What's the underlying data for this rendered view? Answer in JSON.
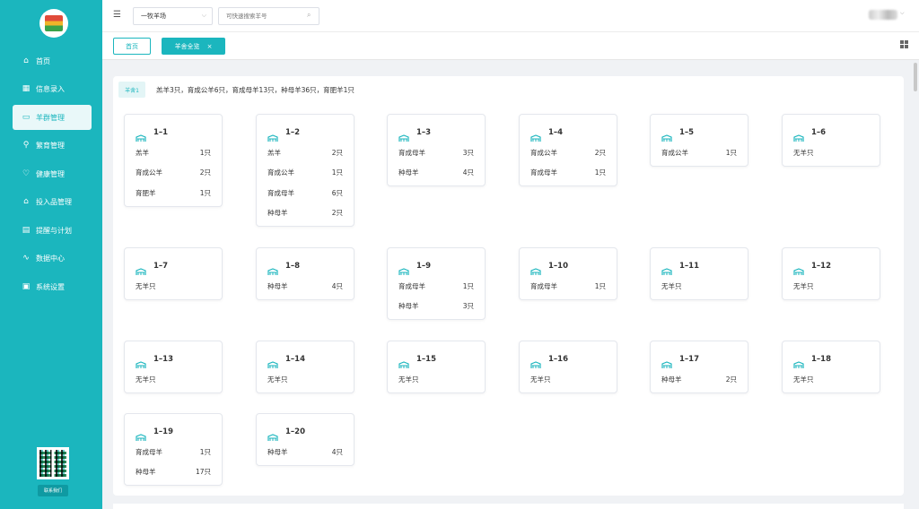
{
  "sidebar": {
    "items": [
      {
        "label": "首页",
        "icon": "home-icon",
        "glyph": "⌂"
      },
      {
        "label": "信息录入",
        "icon": "grid-icon",
        "glyph": "▦"
      },
      {
        "label": "羊群管理",
        "icon": "pen-icon",
        "glyph": "▭",
        "active": true
      },
      {
        "label": "繁育管理",
        "icon": "breeding-icon",
        "glyph": "⚲"
      },
      {
        "label": "健康管理",
        "icon": "health-icon",
        "glyph": "♡"
      },
      {
        "label": "投入品管理",
        "icon": "supplies-icon",
        "glyph": "⌂"
      },
      {
        "label": "提醒与计划",
        "icon": "calendar-icon",
        "glyph": "▤"
      },
      {
        "label": "数据中心",
        "icon": "chart-icon",
        "glyph": "∿"
      },
      {
        "label": "系统设置",
        "icon": "settings-icon",
        "glyph": "▣"
      }
    ],
    "contact_label": "联系我们"
  },
  "topbar": {
    "farm_select": "一牧羊场",
    "search_placeholder": "可快速搜索羊号"
  },
  "tabs": {
    "home": "首页",
    "active": "羊舍全览",
    "close": "×"
  },
  "summary": {
    "tag": "羊舍1",
    "text": "羔羊3只，育成公羊6只，育成母羊13只，种母羊36只，育肥羊1只"
  },
  "pens": [
    {
      "name": "1–1",
      "rows": [
        [
          "羔羊",
          "1只"
        ],
        [
          "育成公羊",
          "2只"
        ],
        [
          "育肥羊",
          "1只"
        ]
      ]
    },
    {
      "name": "1–2",
      "rows": [
        [
          "羔羊",
          "2只"
        ],
        [
          "育成公羊",
          "1只"
        ],
        [
          "育成母羊",
          "6只"
        ],
        [
          "种母羊",
          "2只"
        ]
      ]
    },
    {
      "name": "1–3",
      "rows": [
        [
          "育成母羊",
          "3只"
        ],
        [
          "种母羊",
          "4只"
        ]
      ]
    },
    {
      "name": "1–4",
      "rows": [
        [
          "育成公羊",
          "2只"
        ],
        [
          "育成母羊",
          "1只"
        ]
      ]
    },
    {
      "name": "1–5",
      "rows": [
        [
          "育成公羊",
          "1只"
        ]
      ]
    },
    {
      "name": "1–6",
      "rows": [
        [
          "无羊只",
          ""
        ]
      ]
    },
    {
      "name": "1–7",
      "rows": [
        [
          "无羊只",
          ""
        ]
      ]
    },
    {
      "name": "1–8",
      "rows": [
        [
          "种母羊",
          "4只"
        ]
      ]
    },
    {
      "name": "1–9",
      "rows": [
        [
          "育成母羊",
          "1只"
        ],
        [
          "种母羊",
          "3只"
        ]
      ]
    },
    {
      "name": "1–10",
      "rows": [
        [
          "育成母羊",
          "1只"
        ]
      ]
    },
    {
      "name": "1–11",
      "rows": [
        [
          "无羊只",
          ""
        ]
      ]
    },
    {
      "name": "1–12",
      "rows": [
        [
          "无羊只",
          ""
        ]
      ]
    },
    {
      "name": "1–13",
      "rows": [
        [
          "无羊只",
          ""
        ]
      ]
    },
    {
      "name": "1–14",
      "rows": [
        [
          "无羊只",
          ""
        ]
      ]
    },
    {
      "name": "1–15",
      "rows": [
        [
          "无羊只",
          ""
        ]
      ]
    },
    {
      "name": "1–16",
      "rows": [
        [
          "无羊只",
          ""
        ]
      ]
    },
    {
      "name": "1–17",
      "rows": [
        [
          "种母羊",
          "2只"
        ]
      ]
    },
    {
      "name": "1–18",
      "rows": [
        [
          "无羊只",
          ""
        ]
      ]
    },
    {
      "name": "1–19",
      "rows": [
        [
          "育成母羊",
          "1只"
        ],
        [
          "种母羊",
          "17只"
        ]
      ]
    },
    {
      "name": "1–20",
      "rows": [
        [
          "种母羊",
          "4只"
        ]
      ]
    }
  ],
  "colors": {
    "accent": "#1bb6be",
    "accent_light": "#e3f5f6"
  }
}
